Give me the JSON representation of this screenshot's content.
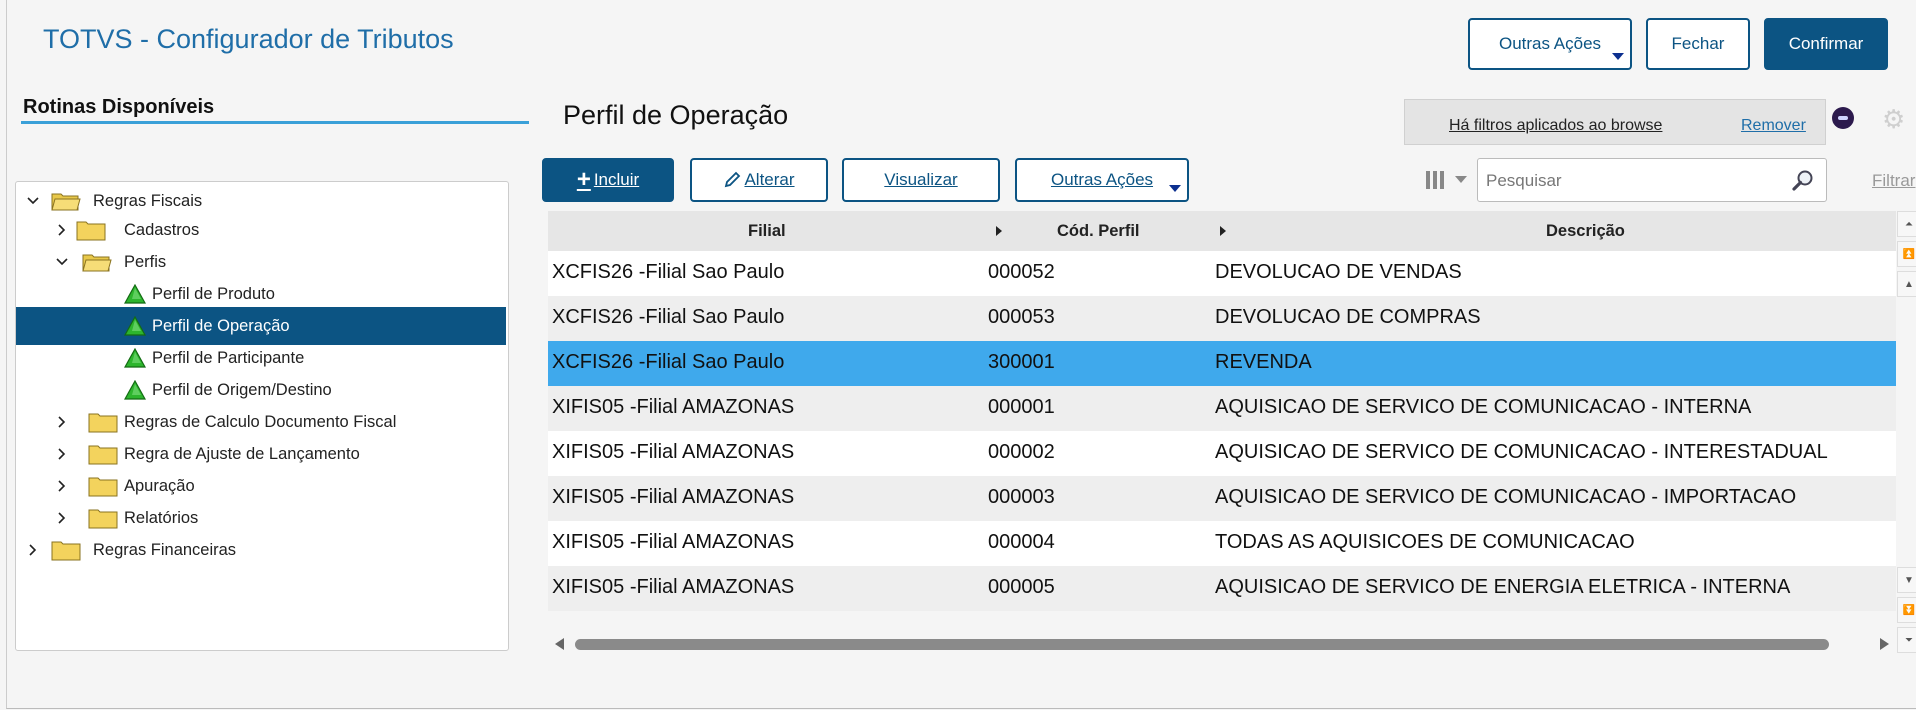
{
  "header": {
    "app_title": "TOTVS - Configurador de Tributos",
    "buttons": {
      "outras_acoes": "Outras Ações",
      "fechar": "Fechar",
      "confirmar": "Confirmar"
    }
  },
  "sidebar": {
    "title": "Rotinas Disponíveis",
    "tree": [
      {
        "label": "Regras Fiscais",
        "level": 0,
        "expanded": true,
        "type": "folder-open"
      },
      {
        "label": "Cadastros",
        "level": 1,
        "expanded": false,
        "type": "folder"
      },
      {
        "label": "Perfis",
        "level": 1,
        "expanded": true,
        "type": "folder-open"
      },
      {
        "label": "Perfil de Produto",
        "level": 2,
        "type": "leaf"
      },
      {
        "label": "Perfil de Operação",
        "level": 2,
        "type": "leaf",
        "selected": true
      },
      {
        "label": "Perfil de Participante",
        "level": 2,
        "type": "leaf"
      },
      {
        "label": "Perfil de Origem/Destino",
        "level": 2,
        "type": "leaf"
      },
      {
        "label": "Regras de Calculo Documento Fiscal",
        "level": 1,
        "expanded": false,
        "type": "folder"
      },
      {
        "label": "Regra de Ajuste de Lançamento",
        "level": 1,
        "expanded": false,
        "type": "folder"
      },
      {
        "label": "Apuração",
        "level": 1,
        "expanded": false,
        "type": "folder"
      },
      {
        "label": "Relatórios",
        "level": 1,
        "expanded": false,
        "type": "folder"
      },
      {
        "label": "Regras Financeiras",
        "level": 0,
        "expanded": false,
        "type": "folder"
      }
    ]
  },
  "main": {
    "title": "Perfil de Operação",
    "filter_notice": "Há filtros aplicados ao browse",
    "remover": "Remover",
    "toolbar": {
      "incluir": "Incluir",
      "alterar": "Alterar",
      "visualizar": "Visualizar",
      "outras_acoes": "Outras Ações"
    },
    "search": {
      "placeholder": "Pesquisar",
      "value": ""
    },
    "filtrar": "Filtrar",
    "grid": {
      "columns": [
        "Filial",
        "Cód. Perfil",
        "Descrição"
      ],
      "rows": [
        [
          "XCFIS26 -Filial Sao Paulo",
          "000052",
          "DEVOLUCAO DE VENDAS"
        ],
        [
          "XCFIS26 -Filial Sao Paulo",
          "000053",
          "DEVOLUCAO DE COMPRAS"
        ],
        [
          "XCFIS26 -Filial Sao Paulo",
          "300001",
          "REVENDA"
        ],
        [
          "XIFIS05 -Filial AMAZONAS",
          "000001",
          "AQUISICAO DE SERVICO DE COMUNICACAO - INTERNA"
        ],
        [
          "XIFIS05 -Filial AMAZONAS",
          "000002",
          "AQUISICAO DE SERVICO DE COMUNICACAO - INTERESTADUAL"
        ],
        [
          "XIFIS05 -Filial AMAZONAS",
          "000003",
          "AQUISICAO DE SERVICO DE COMUNICACAO - IMPORTACAO"
        ],
        [
          "XIFIS05 -Filial AMAZONAS",
          "000004",
          "TODAS AS AQUISICOES DE COMUNICACAO"
        ],
        [
          "XIFIS05 -Filial AMAZONAS",
          "000005",
          "AQUISICAO DE SERVICO DE ENERGIA ELETRICA - INTERNA"
        ]
      ],
      "selected_row": 2
    }
  },
  "colors": {
    "primary": "#0c5483",
    "selection": "#3fa9ec",
    "title": "#1f6ea8",
    "accent_line": "#3aa0d8"
  }
}
